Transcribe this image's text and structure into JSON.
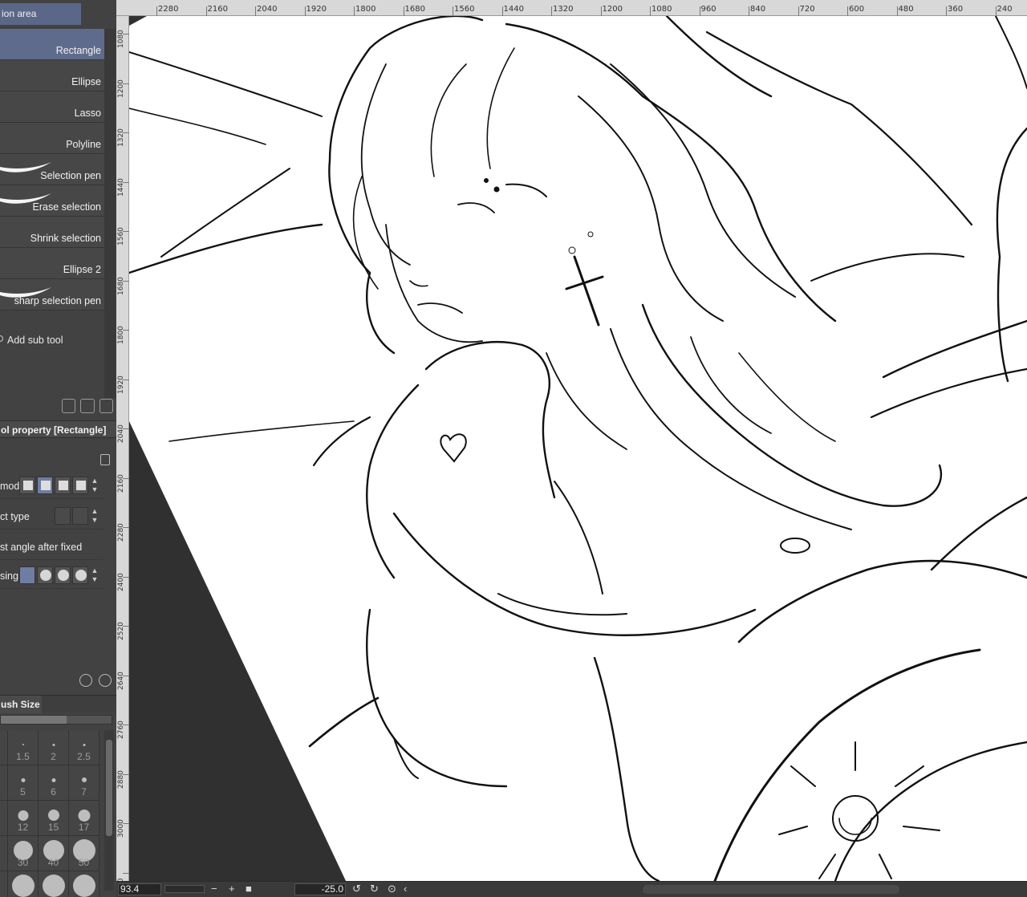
{
  "panel": {
    "tab_label": "ion area",
    "subtools": [
      {
        "label": "Rectangle",
        "selected": true,
        "stroke": false
      },
      {
        "label": "Ellipse",
        "selected": false,
        "stroke": false
      },
      {
        "label": "Lasso",
        "selected": false,
        "stroke": false
      },
      {
        "label": "Polyline",
        "selected": false,
        "stroke": false
      },
      {
        "label": "Selection pen",
        "selected": false,
        "stroke": true
      },
      {
        "label": "Erase selection",
        "selected": false,
        "stroke": true
      },
      {
        "label": "Shrink selection",
        "selected": false,
        "stroke": false
      },
      {
        "label": "Ellipse 2",
        "selected": false,
        "stroke": false
      },
      {
        "label": "sharp selection pen",
        "selected": false,
        "stroke": true
      }
    ],
    "add_subtool": "Add sub tool"
  },
  "tool_property": {
    "header": "ol property [Rectangle]",
    "rows": [
      {
        "label": "mode"
      },
      {
        "label": "ct type"
      },
      {
        "label": "st angle after fixed"
      },
      {
        "label": "sing"
      }
    ]
  },
  "brush_size": {
    "header": "ush Size",
    "cells": [
      "",
      "1.5",
      "2",
      "2.5",
      "",
      "5",
      "6",
      "7",
      "",
      "12",
      "15",
      "17",
      "",
      "30",
      "40",
      "50",
      "",
      "",
      "",
      ""
    ]
  },
  "rulers": {
    "top": [
      "2280",
      "2160",
      "2040",
      "1920",
      "1800",
      "1680",
      "1560",
      "1440",
      "1320",
      "1200",
      "1080",
      "960",
      "840",
      "720",
      "600",
      "480",
      "360",
      "240"
    ],
    "left": [
      "1080",
      "1200",
      "1320",
      "1440",
      "1560",
      "1680",
      "1800",
      "1920",
      "2040",
      "2160",
      "2280",
      "2400",
      "2520",
      "2640",
      "2760",
      "2880",
      "3000",
      "20"
    ]
  },
  "status_bar": {
    "zoom": "93.4",
    "minus": "−",
    "plus": "+",
    "angle": "-25.0"
  }
}
